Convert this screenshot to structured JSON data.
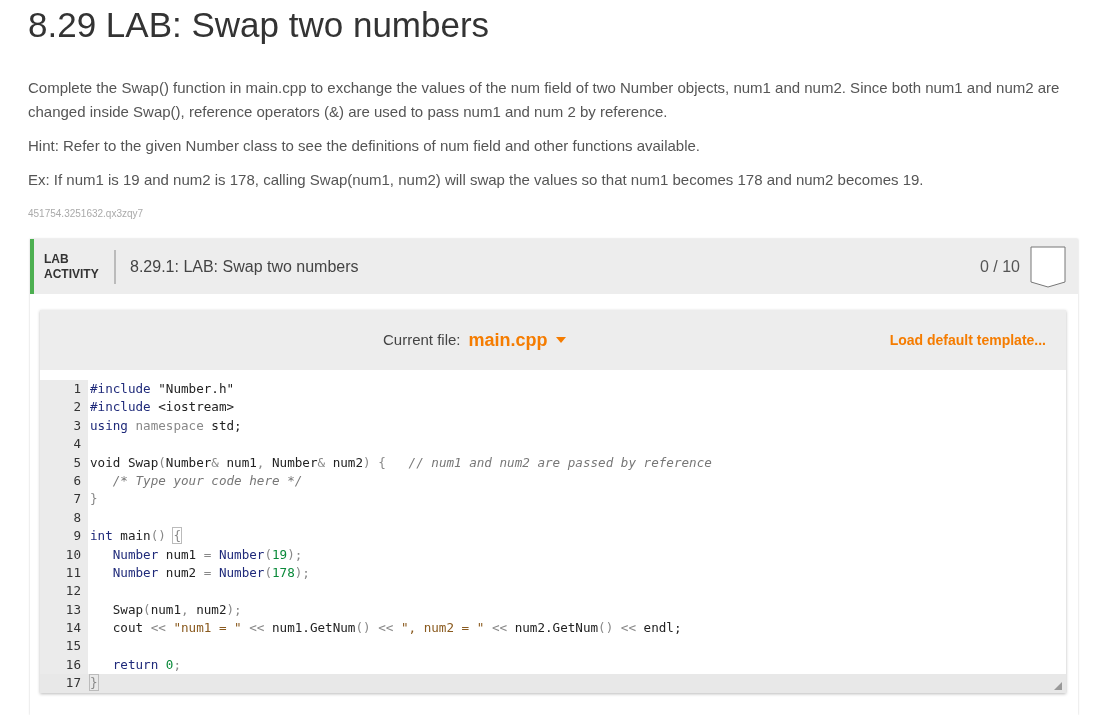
{
  "title": "8.29 LAB: Swap two numbers",
  "paragraphs": [
    "Complete the Swap() function in main.cpp to exchange the values of the num field of two Number objects, num1 and num2. Since both num1 and num2 are changed inside Swap(), reference operators (&) are used to pass num1 and num 2 by reference.",
    "Hint: Refer to the given Number class to see the definitions of num field and other functions available.",
    "Ex: If num1 is 19 and num2 is 178, calling Swap(num1, num2) will swap the values so that num1 becomes 178 and num2 becomes 19."
  ],
  "content_id": "451754.3251632.qx3zqy7",
  "activity": {
    "type_label": "LAB ACTIVITY",
    "title": "8.29.1: LAB: Swap two numbers",
    "score": "0 / 10"
  },
  "editor": {
    "file_label": "Current file:",
    "file_name": "main.cpp",
    "load_template": "Load default template...",
    "lines": [
      {
        "num": "1",
        "active": false,
        "tokens": [
          {
            "kind": "keyword",
            "text": "#include"
          },
          {
            "kind": "plain",
            "text": " \"Number.h\""
          }
        ]
      },
      {
        "num": "2",
        "active": false,
        "tokens": [
          {
            "kind": "keyword",
            "text": "#include"
          },
          {
            "kind": "plain",
            "text": " <iostream>"
          }
        ]
      },
      {
        "num": "3",
        "active": false,
        "tokens": [
          {
            "kind": "keyword",
            "text": "using"
          },
          {
            "kind": "operator",
            "text": " namespace"
          },
          {
            "kind": "plain",
            "text": " std;"
          }
        ]
      },
      {
        "num": "4",
        "active": false
      },
      {
        "num": "5",
        "active": false,
        "tokens": [
          {
            "kind": "plain",
            "text": "void Swap"
          },
          {
            "kind": "operator",
            "text": "("
          },
          {
            "kind": "plain",
            "text": "Number"
          },
          {
            "kind": "operator",
            "text": "&"
          },
          {
            "kind": "plain",
            "text": " num1"
          },
          {
            "kind": "operator",
            "text": ","
          },
          {
            "kind": "plain",
            "text": " Number"
          },
          {
            "kind": "operator",
            "text": "&"
          },
          {
            "kind": "plain",
            "text": " num2"
          },
          {
            "kind": "operator",
            "text": ") {   "
          },
          {
            "kind": "comment",
            "text": "// num1 and num2 are passed by reference"
          }
        ]
      },
      {
        "num": "6",
        "active": false,
        "tokens": [
          {
            "kind": "comment",
            "text": "   /* Type your code here */"
          }
        ]
      },
      {
        "num": "7",
        "active": false,
        "tokens": [
          {
            "kind": "operator",
            "text": "}"
          }
        ]
      },
      {
        "num": "8",
        "active": false
      },
      {
        "num": "9",
        "active": false,
        "tokens": [
          {
            "kind": "keyword",
            "text": "int"
          },
          {
            "kind": "plain",
            "text": " main"
          },
          {
            "kind": "operator",
            "text": "() "
          },
          {
            "kind": "match",
            "text": "{"
          }
        ]
      },
      {
        "num": "10",
        "active": false,
        "tokens": [
          {
            "kind": "keyword",
            "text": "   Number"
          },
          {
            "kind": "plain",
            "text": " num1 "
          },
          {
            "kind": "operator",
            "text": "="
          },
          {
            "kind": "keyword",
            "text": " Number"
          },
          {
            "kind": "operator",
            "text": "("
          },
          {
            "kind": "number",
            "text": "19"
          },
          {
            "kind": "operator",
            "text": ");"
          }
        ]
      },
      {
        "num": "11",
        "active": false,
        "tokens": [
          {
            "kind": "keyword",
            "text": "   Number"
          },
          {
            "kind": "plain",
            "text": " num2 "
          },
          {
            "kind": "operator",
            "text": "="
          },
          {
            "kind": "keyword",
            "text": " Number"
          },
          {
            "kind": "operator",
            "text": "("
          },
          {
            "kind": "number",
            "text": "178"
          },
          {
            "kind": "operator",
            "text": ");"
          }
        ]
      },
      {
        "num": "12",
        "active": false
      },
      {
        "num": "13",
        "active": false,
        "tokens": [
          {
            "kind": "plain",
            "text": "   Swap"
          },
          {
            "kind": "operator",
            "text": "("
          },
          {
            "kind": "plain",
            "text": "num1"
          },
          {
            "kind": "operator",
            "text": ","
          },
          {
            "kind": "plain",
            "text": " num2"
          },
          {
            "kind": "operator",
            "text": ");"
          }
        ]
      },
      {
        "num": "14",
        "active": false,
        "tokens": [
          {
            "kind": "plain",
            "text": "   cout "
          },
          {
            "kind": "operator",
            "text": "<< "
          },
          {
            "kind": "string",
            "text": "\"num1 = \""
          },
          {
            "kind": "operator",
            "text": " << "
          },
          {
            "kind": "plain",
            "text": "num1.GetNum"
          },
          {
            "kind": "operator",
            "text": "() << "
          },
          {
            "kind": "string",
            "text": "\", num2 = \""
          },
          {
            "kind": "operator",
            "text": " << "
          },
          {
            "kind": "plain",
            "text": "num2.GetNum"
          },
          {
            "kind": "operator",
            "text": "() << "
          },
          {
            "kind": "plain",
            "text": "endl;"
          }
        ]
      },
      {
        "num": "15",
        "active": false
      },
      {
        "num": "16",
        "active": false,
        "tokens": [
          {
            "kind": "keyword",
            "text": "   return"
          },
          {
            "kind": "number",
            "text": " 0"
          },
          {
            "kind": "operator",
            "text": ";"
          }
        ]
      },
      {
        "num": "17",
        "active": true,
        "tokens": [
          {
            "kind": "match",
            "text": "}"
          }
        ]
      }
    ]
  }
}
